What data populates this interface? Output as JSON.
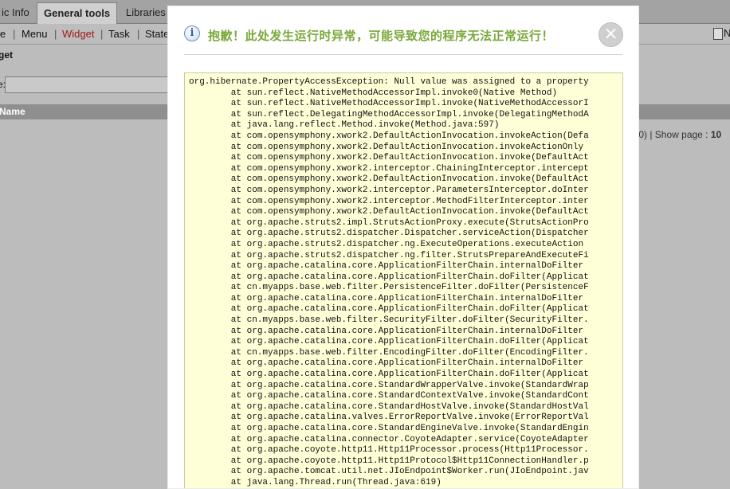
{
  "tabs": [
    {
      "label": "ic Info"
    },
    {
      "label": "General tools",
      "active": true
    },
    {
      "label": "Libraries"
    }
  ],
  "menu": {
    "items": [
      {
        "label": "le"
      },
      {
        "label": "Menu"
      },
      {
        "label": "Widget",
        "active": true
      },
      {
        "label": "Task"
      },
      {
        "label": "State"
      }
    ],
    "separator": "|",
    "right_label": "N"
  },
  "panel": {
    "title": "get",
    "filter_label": "e:",
    "filter_value": "",
    "column_header": "Name"
  },
  "pager": {
    "text_before": "/0)  |  Show page : ",
    "page": "10"
  },
  "dialog": {
    "icon": "info-icon",
    "title": "抱歉！此处发生运行时异常，可能导致您的程序无法正常运行！",
    "close_glyph": "×",
    "trace_lines": [
      "org.hibernate.PropertyAccessException: Null value was assigned to a property",
      "        at sun.reflect.NativeMethodAccessorImpl.invoke0(Native Method)",
      "        at sun.reflect.NativeMethodAccessorImpl.invoke(NativeMethodAccessorI",
      "        at sun.reflect.DelegatingMethodAccessorImpl.invoke(DelegatingMethodA",
      "        at java.lang.reflect.Method.invoke(Method.java:597)",
      "        at com.opensymphony.xwork2.DefaultActionInvocation.invokeAction(Defa",
      "        at com.opensymphony.xwork2.DefaultActionInvocation.invokeActionOnly",
      "        at com.opensymphony.xwork2.DefaultActionInvocation.invoke(DefaultAct",
      "        at com.opensymphony.xwork2.interceptor.ChainingInterceptor.intercept",
      "        at com.opensymphony.xwork2.DefaultActionInvocation.invoke(DefaultAct",
      "        at com.opensymphony.xwork2.interceptor.ParametersInterceptor.doInter",
      "        at com.opensymphony.xwork2.interceptor.MethodFilterInterceptor.inter",
      "        at com.opensymphony.xwork2.DefaultActionInvocation.invoke(DefaultAct",
      "        at org.apache.struts2.impl.StrutsActionProxy.execute(StrutsActionPro",
      "        at org.apache.struts2.dispatcher.Dispatcher.serviceAction(Dispatcher",
      "        at org.apache.struts2.dispatcher.ng.ExecuteOperations.executeAction",
      "        at org.apache.struts2.dispatcher.ng.filter.StrutsPrepareAndExecuteFi",
      "        at org.apache.catalina.core.ApplicationFilterChain.internalDoFilter",
      "        at org.apache.catalina.core.ApplicationFilterChain.doFilter(Applicat",
      "        at cn.myapps.base.web.filter.PersistenceFilter.doFilter(PersistenceF",
      "        at org.apache.catalina.core.ApplicationFilterChain.internalDoFilter",
      "        at org.apache.catalina.core.ApplicationFilterChain.doFilter(Applicat",
      "        at cn.myapps.base.web.filter.SecurityFilter.doFilter(SecurityFilter.",
      "        at org.apache.catalina.core.ApplicationFilterChain.internalDoFilter",
      "        at org.apache.catalina.core.ApplicationFilterChain.doFilter(Applicat",
      "        at cn.myapps.base.web.filter.EncodingFilter.doFilter(EncodingFilter.",
      "        at org.apache.catalina.core.ApplicationFilterChain.internalDoFilter",
      "        at org.apache.catalina.core.ApplicationFilterChain.doFilter(Applicat",
      "        at org.apache.catalina.core.StandardWrapperValve.invoke(StandardWrap",
      "        at org.apache.catalina.core.StandardContextValve.invoke(StandardCont",
      "        at org.apache.catalina.core.StandardHostValve.invoke(StandardHostVal",
      "        at org.apache.catalina.valves.ErrorReportValve.invoke(ErrorReportVal",
      "        at org.apache.catalina.core.StandardEngineValve.invoke(StandardEngin",
      "        at org.apache.catalina.connector.CoyoteAdapter.service(CoyoteAdapter",
      "        at org.apache.coyote.http11.Http11Processor.process(Http11Processor.",
      "        at org.apache.coyote.http11.Http11Protocol$Http11ConnectionHandler.p",
      "        at org.apache.tomcat.util.net.JIoEndpoint$Worker.run(JIoEndpoint.jav",
      "        at java.lang.Thread.run(Thread.java:619)"
    ]
  },
  "colors": {
    "title_green": "#7aa83a",
    "trace_background": "#ffffd7",
    "active_menu_red": "#a01818",
    "overlay_gray": "#bcbcbc"
  }
}
